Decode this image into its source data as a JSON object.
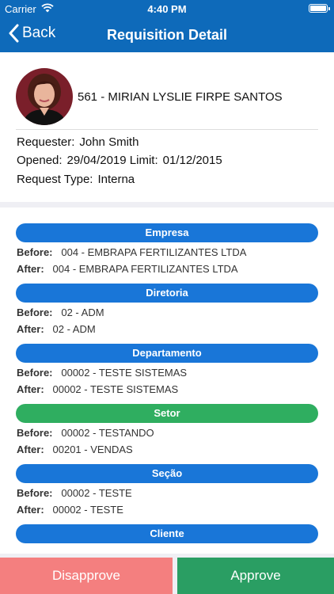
{
  "status_bar": {
    "carrier": "Carrier",
    "time": "4:40 PM"
  },
  "nav": {
    "back_label": "Back",
    "title": "Requisition Detail"
  },
  "employee": {
    "name": "561 - MIRIAN LYSLIE FIRPE SANTOS"
  },
  "details": {
    "requester_label": "Requester:",
    "requester": "John Smith",
    "opened_label": "Opened:",
    "opened": "29/04/2019",
    "limit_label": "Limit:",
    "limit": "01/12/2015",
    "type_label": "Request Type:",
    "type": "Interna"
  },
  "labels": {
    "before": "Before:",
    "after": "After:"
  },
  "changes": [
    {
      "title": "Empresa",
      "color": "#1976d8",
      "before": "004 - EMBRAPA FERTILIZANTES LTDA",
      "after": "004 - EMBRAPA FERTILIZANTES LTDA"
    },
    {
      "title": "Diretoria",
      "color": "#1976d8",
      "before": "02 - ADM",
      "after": "02 - ADM"
    },
    {
      "title": "Departamento",
      "color": "#1976d8",
      "before": "00002 - TESTE SISTEMAS",
      "after": "00002 - TESTE SISTEMAS"
    },
    {
      "title": "Setor",
      "color": "#2fae60",
      "before": "00002 - TESTANDO",
      "after": "00201 - VENDAS"
    },
    {
      "title": "Seção",
      "color": "#1976d8",
      "before": "00002 - TESTE",
      "after": "00002 - TESTE"
    },
    {
      "title": "Cliente",
      "color": "#1976d8"
    }
  ],
  "actions": {
    "disapprove_label": "Disapprove",
    "approve_label": "Approve",
    "disapprove_color": "#f47f7f",
    "approve_color": "#2a9e63"
  },
  "colors": {
    "header": "#0e6aba"
  }
}
